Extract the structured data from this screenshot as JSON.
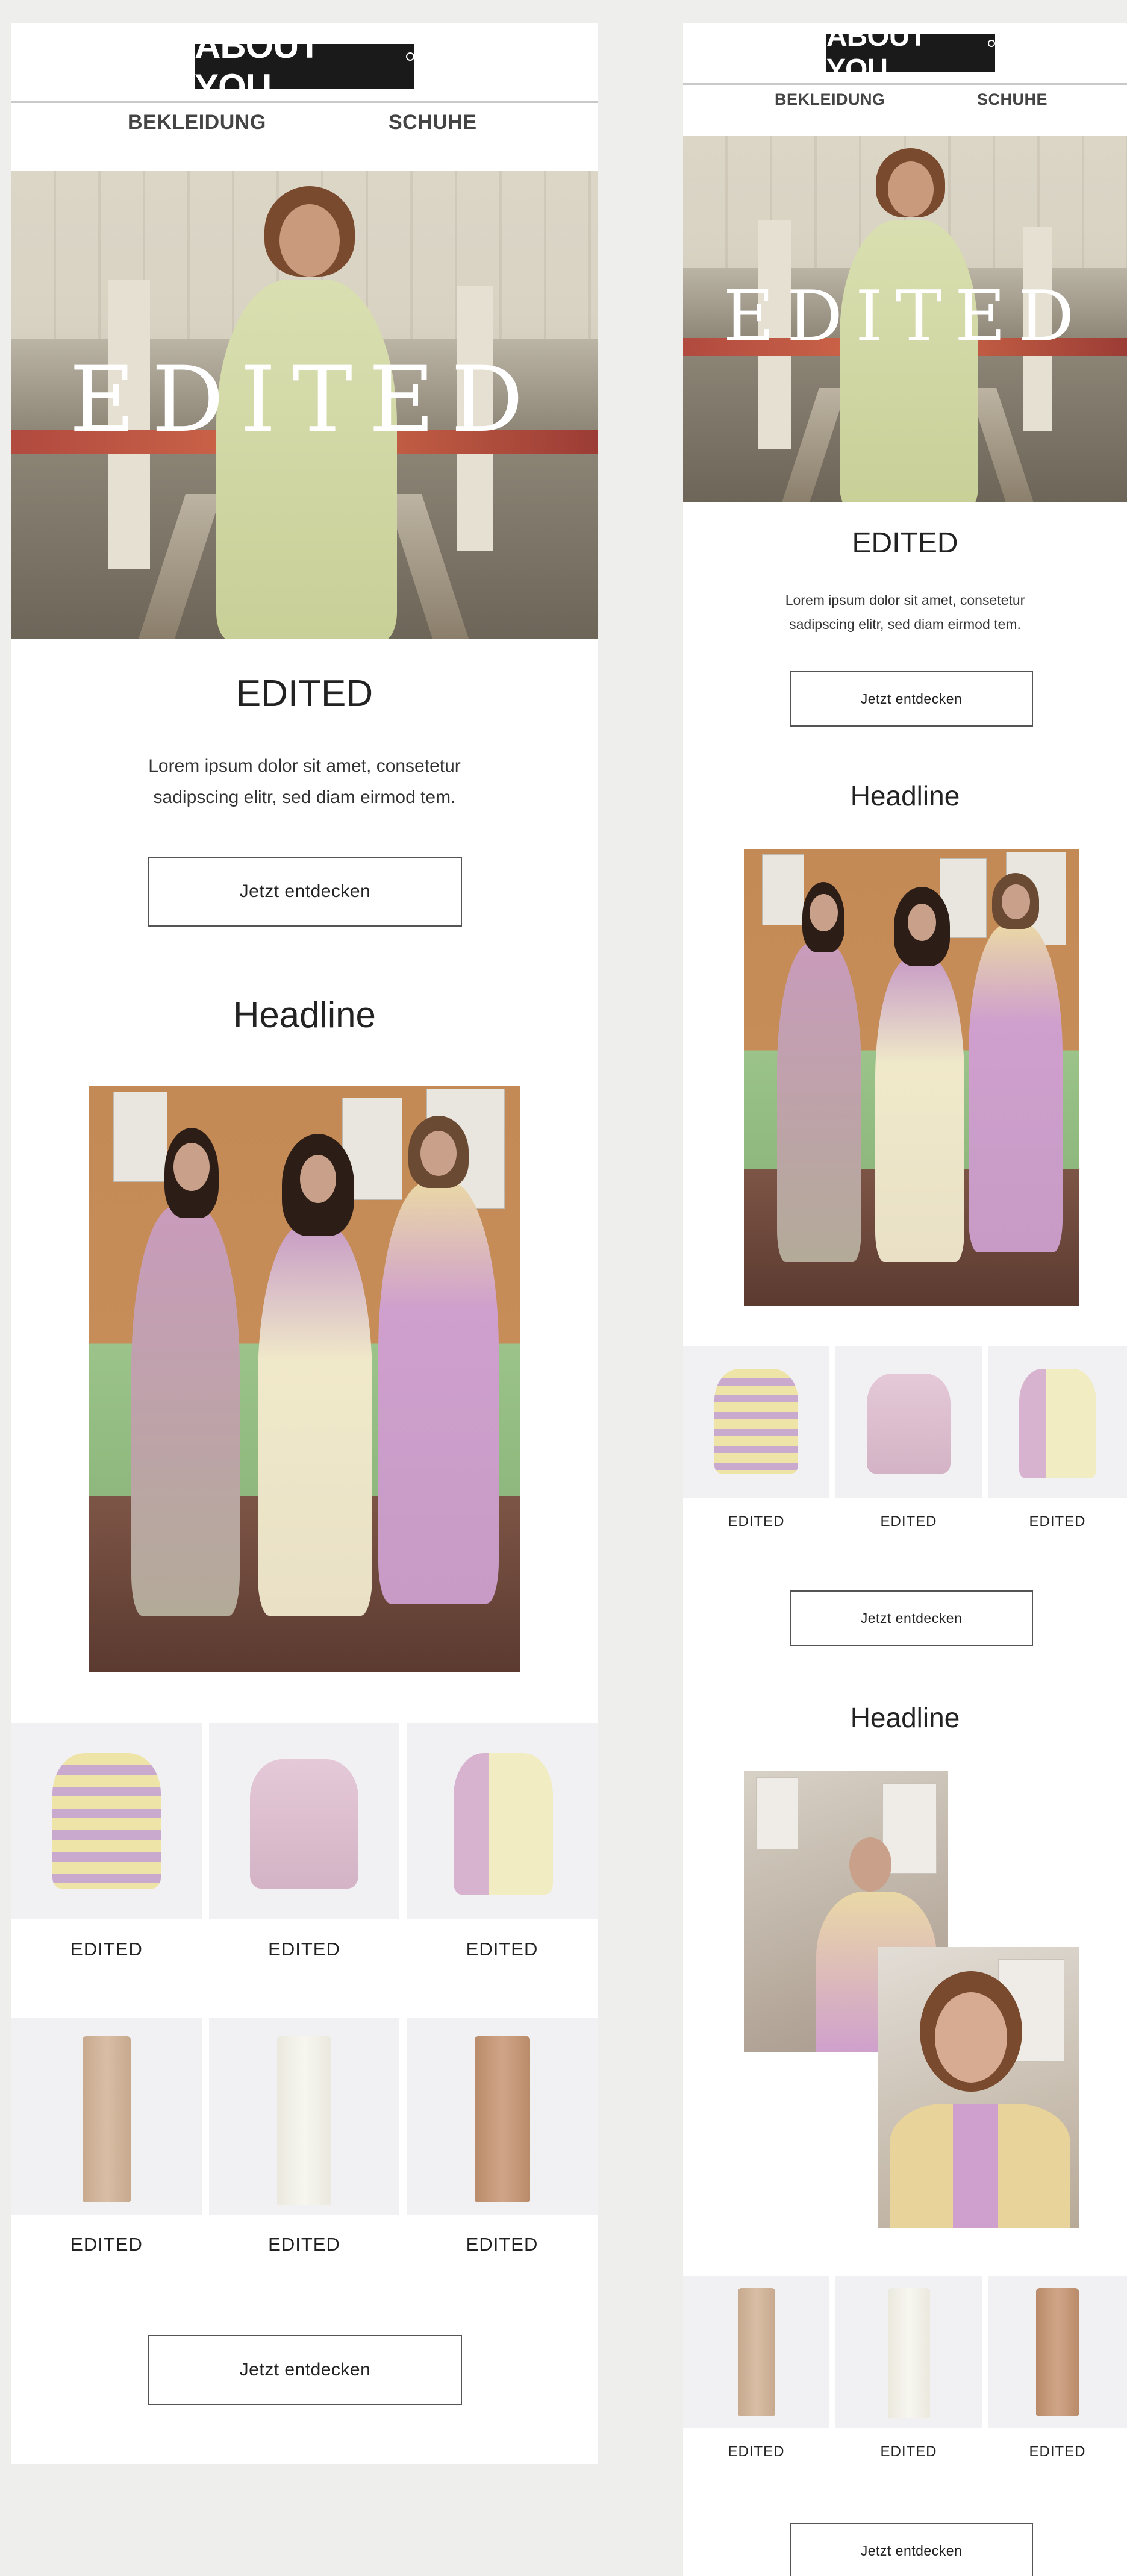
{
  "brand": {
    "logo_text": "ABOUT YOU"
  },
  "nav": {
    "items": [
      "BEKLEIDUNG",
      "SCHUHE"
    ]
  },
  "hero": {
    "overlay_text": "EDITED"
  },
  "intro": {
    "title": "EDITED",
    "body_lines": [
      "Lorem ipsum dolor sit amet, consetetur",
      "sadipscing elitr, sed diam eirmod tem."
    ],
    "cta": "Jetzt entdecken"
  },
  "section1": {
    "headline": "Headline"
  },
  "section2": {
    "headline": "Headline"
  },
  "products_tops": [
    {
      "label": "EDITED",
      "icon": "striped-cardigan"
    },
    {
      "label": "EDITED",
      "icon": "pink-jacket"
    },
    {
      "label": "EDITED",
      "icon": "colorblock-sweater"
    }
  ],
  "products_pants": [
    {
      "label": "EDITED",
      "icon": "beige-leather-pants"
    },
    {
      "label": "EDITED",
      "icon": "white-trousers"
    },
    {
      "label": "EDITED",
      "icon": "tan-flared-pants"
    }
  ],
  "cta_secondary": "Jetzt entdecken",
  "colors": {
    "background": "#eeeeec",
    "panel": "#ffffff",
    "logo_bg": "#1a1a1a",
    "tile_bg": "#f1f1f3",
    "button_border": "#555555"
  }
}
